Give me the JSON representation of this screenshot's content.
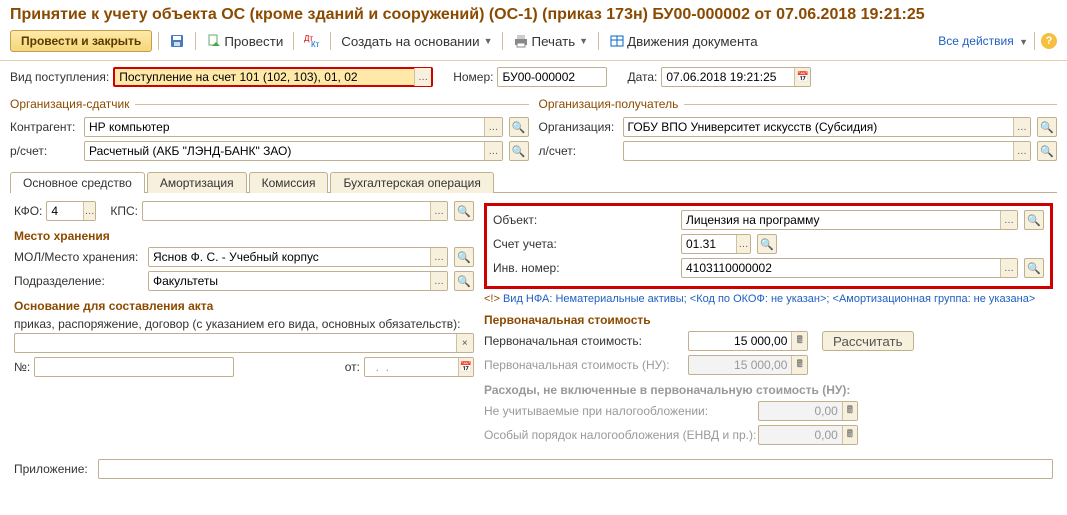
{
  "title": "Принятие к учету объекта ОС (кроме зданий и сооружений) (ОС-1) (приказ 173н) БУ00-000002 от 07.06.2018 19:21:25",
  "toolbar": {
    "post_close": "Провести и закрыть",
    "post": "Провести",
    "create_based": "Создать на основании",
    "print": "Печать",
    "movements": "Движения документа",
    "all_actions": "Все действия"
  },
  "header": {
    "type_label": "Вид поступления:",
    "type_value": "Поступление на счет 101 (102, 103), 01, 02",
    "number_label": "Номер:",
    "number_value": "БУ00-000002",
    "date_label": "Дата:",
    "date_value": "07.06.2018 19:21:25"
  },
  "sender": {
    "legend": "Организация-сдатчик",
    "contragent_label": "Контрагент:",
    "contragent_value": "НР компьютер",
    "rschet_label": "р/счет:",
    "rschet_value": "Расчетный (АКБ \"ЛЭНД-БАНК\" ЗАО)"
  },
  "receiver": {
    "legend": "Организация-получатель",
    "org_label": "Организация:",
    "org_value": "ГОБУ ВПО Университет искусств (Субсидия)",
    "lschet_label": "л/счет:"
  },
  "tabs": {
    "t1": "Основное средство",
    "t2": "Амортизация",
    "t3": "Комиссия",
    "t4": "Бухгалтерская операция"
  },
  "main": {
    "kfo_label": "КФО:",
    "kfo_value": "4",
    "kps_label": "КПС:",
    "storage_title": "Место хранения",
    "mol_label": "МОЛ/Место хранения:",
    "mol_value": "Яснов Ф. С. - Учебный корпус",
    "dept_label": "Подразделение:",
    "dept_value": "Факультеты",
    "basis_title": "Основание для составления акта",
    "basis_desc": "приказ, распоряжение, договор (с указанием его вида, основных обязательств):",
    "num_label": "№:",
    "from_label": "от:"
  },
  "object": {
    "obj_label": "Объект:",
    "obj_value": "Лицензия на программу",
    "acc_label": "Счет учета:",
    "acc_value": "01.31",
    "inv_label": "Инв. номер:",
    "inv_value": "4103110000002",
    "info_prefix": "<!>",
    "info_nfa": "Вид НФА: Нематериальные активы;",
    "info_okof": "<Код по ОКОФ: не указан>;",
    "info_amort": "<Амортизационная группа: не указана>"
  },
  "cost": {
    "title": "Первоначальная стоимость",
    "pv_label": "Первоначальная стоимость:",
    "pv_value": "15 000,00",
    "calc_btn": "Рассчитать",
    "pvnu_label": "Первоначальная стоимость (НУ):",
    "pvnu_value": "15 000,00",
    "exp_title": "Расходы, не включенные в первоначальную стоимость (НУ):",
    "tax_label": "Не учитываемые при налогообложении:",
    "tax_value": "0,00",
    "envd_label": "Особый порядок налогообложения (ЕНВД и пр.):",
    "envd_value": "0,00"
  },
  "attach_label": "Приложение:"
}
